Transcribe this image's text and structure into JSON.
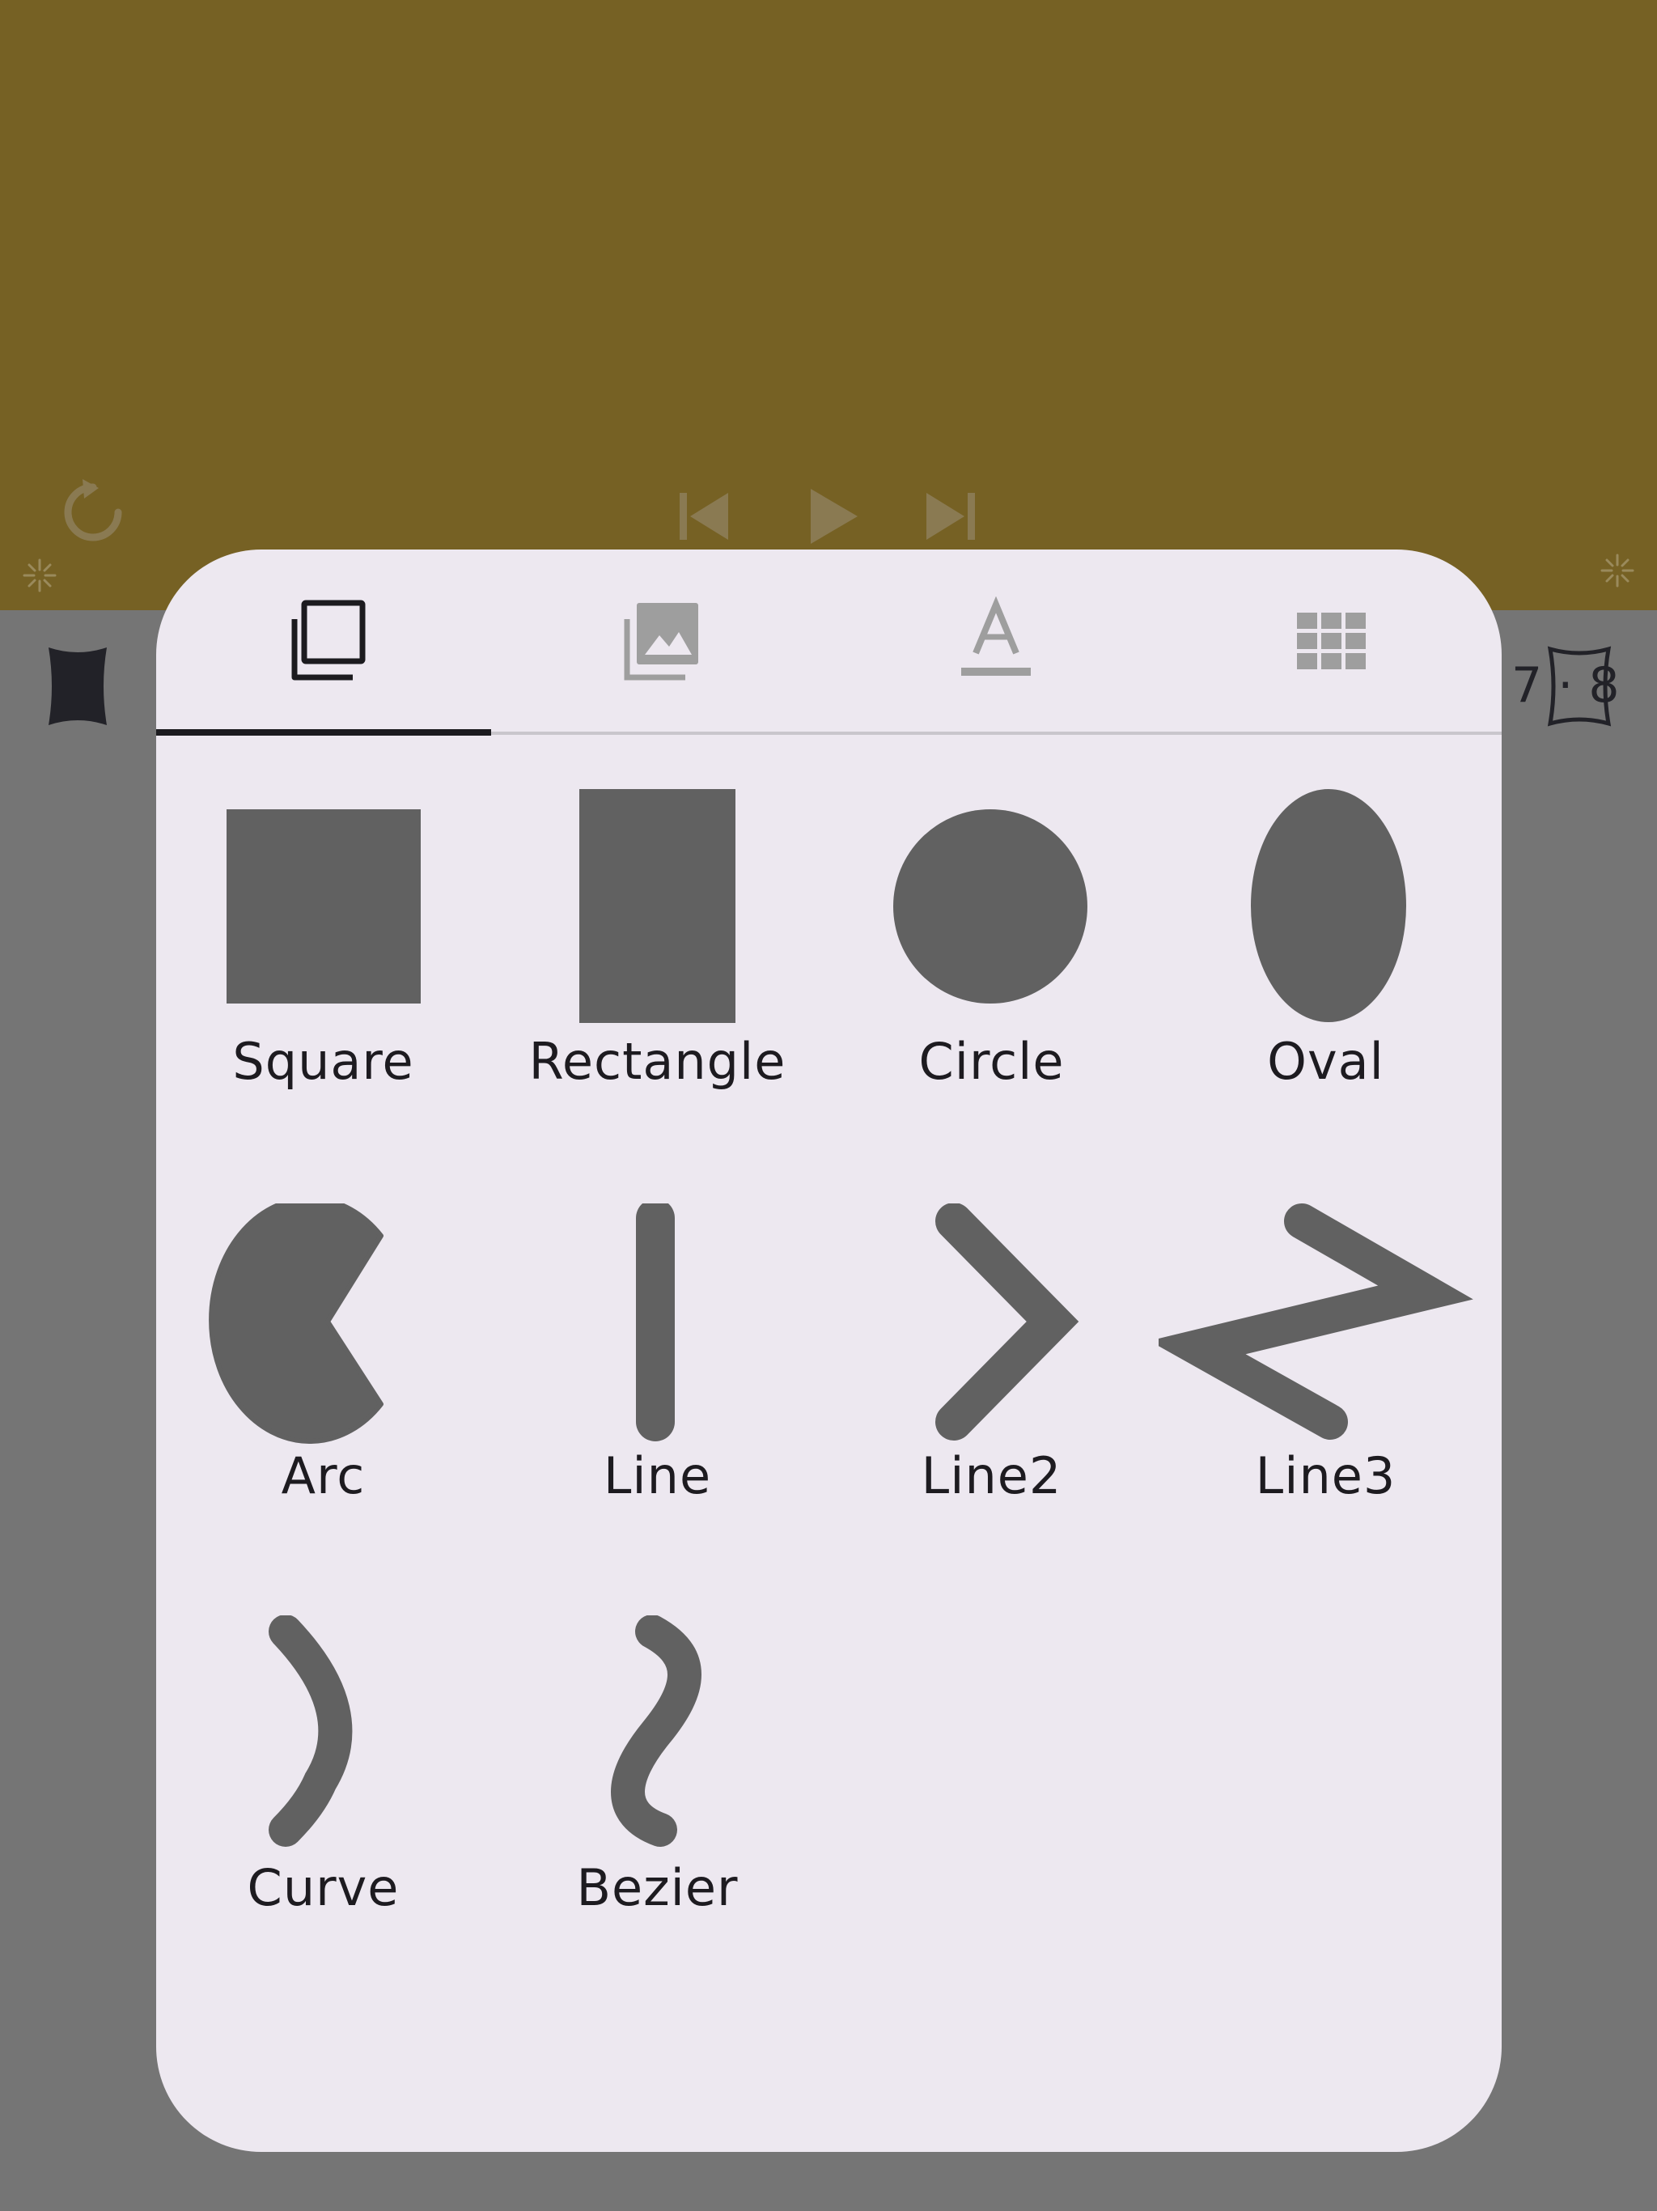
{
  "colors": {
    "canvas_background": "#766124",
    "scrim": "#757575",
    "panel": "#ede8f0",
    "shape_fill": "#616161",
    "tab_active": "#1c1b1f",
    "tab_inactive": "#9e9e9e"
  },
  "background": {
    "controls": [
      {
        "name": "reset-icon"
      },
      {
        "name": "skip-previous-icon"
      },
      {
        "name": "play-icon"
      },
      {
        "name": "skip-next-icon"
      }
    ],
    "ruler_text": "7 · 8"
  },
  "tabs": [
    {
      "name": "tab-shapes",
      "icon": "layers-icon",
      "active": true
    },
    {
      "name": "tab-images",
      "icon": "photo-library-icon",
      "active": false
    },
    {
      "name": "tab-text",
      "icon": "text-format-icon",
      "active": false
    },
    {
      "name": "tab-grid",
      "icon": "grid-icon",
      "active": false
    }
  ],
  "shapes": [
    {
      "label": "Square",
      "icon": "square-icon"
    },
    {
      "label": "Rectangle",
      "icon": "rectangle-icon"
    },
    {
      "label": "Circle",
      "icon": "circle-icon"
    },
    {
      "label": "Oval",
      "icon": "oval-icon"
    },
    {
      "label": "Arc",
      "icon": "arc-icon"
    },
    {
      "label": "Line",
      "icon": "line-icon"
    },
    {
      "label": "Line2",
      "icon": "line2-icon"
    },
    {
      "label": "Line3",
      "icon": "line3-icon"
    },
    {
      "label": "Curve",
      "icon": "curve-icon"
    },
    {
      "label": "Bezier",
      "icon": "bezier-icon"
    }
  ]
}
